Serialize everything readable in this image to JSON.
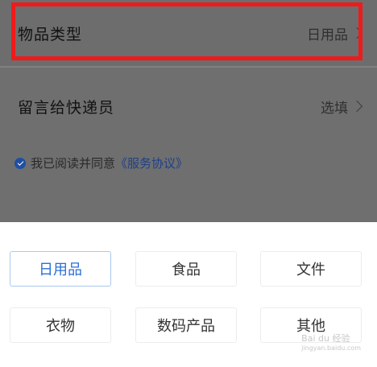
{
  "form": {
    "item_type": {
      "label": "物品类型",
      "value": "日用品"
    },
    "message": {
      "label": "留言给快递员",
      "value": "选填"
    },
    "agreement": {
      "prefix": "我已阅读并同意",
      "link": "《服务协议》"
    }
  },
  "options": [
    "日用品",
    "食品",
    "文件",
    "衣物",
    "数码产品",
    "其他"
  ],
  "selected_option": "日用品",
  "watermark": {
    "text": "Bai du 经验",
    "sub": "jingyan.baidu.com"
  },
  "colors": {
    "highlight": "#f01a1a",
    "selected": "#2b6fd6"
  }
}
